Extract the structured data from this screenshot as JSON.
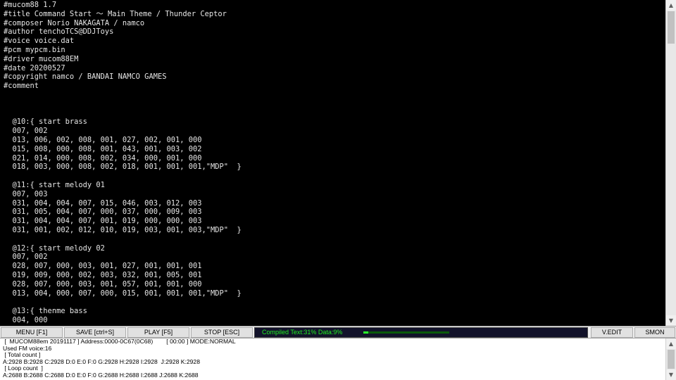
{
  "editor": {
    "lines": [
      "#mucom88 1.7",
      "#title Command Start ～ Main Theme / Thunder Ceptor",
      "#composer Norio NAKAGATA / namco",
      "#author tenchoTCS@DDJToys",
      "#voice voice.dat",
      "#pcm mypcm.bin",
      "#driver mucom88EM",
      "#date 20200527",
      "#copyright namco / BANDAI NAMCO GAMES",
      "#comment",
      "",
      "",
      "",
      "  @10:{ start brass",
      "  007, 002",
      "  013, 006, 002, 008, 001, 027, 002, 001, 000",
      "  015, 008, 000, 008, 001, 043, 001, 003, 002",
      "  021, 014, 000, 008, 002, 034, 000, 001, 000",
      "  018, 003, 000, 008, 002, 018, 001, 001, 001,\"MDP\"  }",
      "",
      "  @11:{ start melody 01",
      "  007, 003",
      "  031, 004, 004, 007, 015, 046, 003, 012, 003",
      "  031, 005, 004, 007, 000, 037, 000, 009, 003",
      "  031, 004, 004, 007, 001, 019, 000, 000, 003",
      "  031, 001, 002, 012, 010, 019, 003, 001, 003,\"MDP\"  }",
      "",
      "  @12:{ start melody 02",
      "  007, 002",
      "  028, 007, 000, 003, 001, 027, 001, 001, 001",
      "  019, 009, 000, 002, 003, 032, 001, 005, 001",
      "  028, 007, 000, 003, 001, 057, 001, 001, 000",
      "  013, 004, 000, 007, 000, 015, 001, 001, 001,\"MDP\"  }",
      "",
      "  @13:{ thenme bass",
      "  004, 000"
    ]
  },
  "toolbar": {
    "menu_label": "MENU [F1]",
    "save_label": "SAVE [ctrl+S]",
    "play_label": "PLAY [F5]",
    "stop_label": "STOP [ESC]",
    "status_text": "Compiled Text:31% Data:9%",
    "progress": 0.06,
    "vedit_label": "V.EDIT",
    "smon_label": "SMON"
  },
  "log": {
    "lines": [
      " [  MUCOM88em 20191117 ] Address:0000-0C67(0C68)        [ 00:00 ] MODE:NORMAL",
      "Used FM voice:16",
      " [ Total count ]",
      "A:2928 B:2928 C:2928 D:0 E:0 F:0 G:2928 H:2928 I:2928  J:2928 K:2928",
      " [ Loop count  ]",
      "A:2688 B:2688 C:2688 D:0 E:0 F:0 G:2688 H:2688 I:2688 J:2688 K:2688"
    ]
  },
  "colors": {
    "editor_bg": "#000000",
    "editor_fg": "#e6e6e6",
    "status_text": "#22ee22",
    "status_bg": "#12122a"
  }
}
